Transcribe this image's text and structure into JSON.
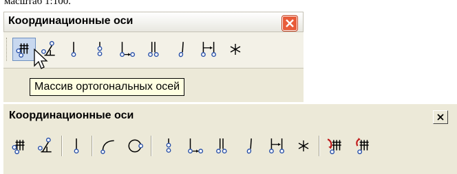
{
  "caption": "масштаб 1:100.",
  "toolbar_xp": {
    "title": "Координационные оси",
    "close_icon": "close-icon",
    "tooltip": "Массив ортогональных осей",
    "buttons": [
      {
        "icon": "orthogonal-axes-array-icon"
      },
      {
        "icon": "axis-with-angle-icon"
      },
      {
        "icon": "single-axis-icon"
      },
      {
        "icon": "axis-two-markers-icon"
      },
      {
        "icon": "axis-dimension-icon"
      },
      {
        "icon": "double-axis-icon"
      },
      {
        "icon": "slanted-axis-icon"
      },
      {
        "icon": "axis-span-dimension-icon"
      },
      {
        "icon": "asterisk-axes-icon"
      }
    ]
  },
  "toolbar_classic": {
    "title": "Координационные оси",
    "close_icon": "close-icon",
    "buttons": [
      {
        "icon": "orthogonal-axes-array-icon"
      },
      {
        "icon": "axis-with-angle-icon"
      },
      {
        "icon": "single-axis-icon"
      },
      {
        "icon": "arc-axis-icon"
      },
      {
        "icon": "circle-axis-icon"
      },
      {
        "icon": "axis-two-markers-icon"
      },
      {
        "icon": "axis-dimension-icon"
      },
      {
        "icon": "double-axis-icon"
      },
      {
        "icon": "slanted-axis-icon"
      },
      {
        "icon": "axis-span-dimension-icon"
      },
      {
        "icon": "asterisk-axes-icon"
      },
      {
        "icon": "axes-edit-red-icon"
      },
      {
        "icon": "axes-renumber-red-icon"
      }
    ]
  },
  "colors": {
    "icon_blue": "#2850a8",
    "icon_black": "#000000",
    "icon_red": "#c01818",
    "close_red": "#e85c3a",
    "tooltip_bg": "#ffffe1"
  }
}
